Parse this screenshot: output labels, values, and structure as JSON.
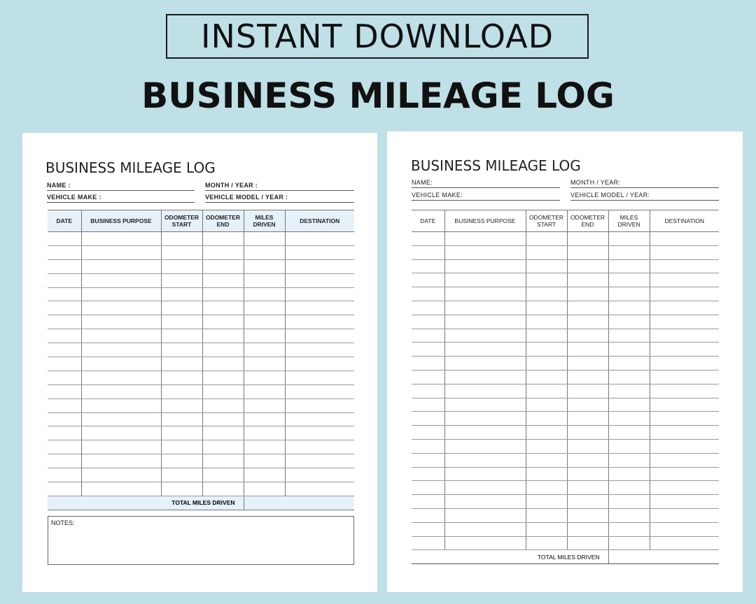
{
  "banner": "INSTANT DOWNLOAD",
  "main_title": "BUSINESS MILEAGE LOG",
  "left_sheet": {
    "title": "BUSINESS MILEAGE LOG",
    "name_label": "NAME :",
    "month_year_label": "MONTH / YEAR :",
    "vehicle_make_label": "VEHICLE MAKE :",
    "vehicle_model_label": "VEHICLE MODEL / YEAR :",
    "columns": {
      "date": "DATE",
      "purpose": "BUSINESS PURPOSE",
      "odo_start": "ODOMETER START",
      "odo_end": "ODOMETER END",
      "miles": "MILES DRIVEN",
      "destination": "DESTINATION"
    },
    "row_count": 19,
    "total_label": "TOTAL MILES DRIVEN",
    "notes_label": "NOTES:"
  },
  "right_sheet": {
    "title": "BUSINESS MILEAGE LOG",
    "name_label": "NAME:",
    "month_year_label": "MONTH / YEAR:",
    "vehicle_make_label": "VEHICLE MAKE:",
    "vehicle_model_label": "VEHICLE MODEL / YEAR:",
    "columns": {
      "date": "DATE",
      "purpose": "BUSINESS PURPOSE",
      "odo_start": "ODOMETER START",
      "odo_end": "ODOMETER END",
      "miles": "MILES DRIVEN",
      "destination": "DESTINATION"
    },
    "row_count": 23,
    "total_label": "TOTAL MILES  DRIVEN"
  },
  "colors": {
    "background": "#bfe0e7",
    "sheet": "#ffffff",
    "header_tint": "#e6f1fa"
  }
}
